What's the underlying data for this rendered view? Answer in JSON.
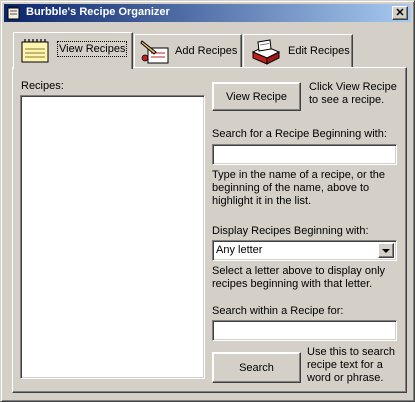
{
  "window": {
    "title": "Burbble's Recipe Organizer",
    "close_glyph": "✕",
    "icon": "recipe-book-icon"
  },
  "tabs": [
    {
      "label": "View Recipes",
      "icon": "notepad-icon",
      "active": true
    },
    {
      "label": "Add Recipes",
      "icon": "pencil-note-icon",
      "active": false
    },
    {
      "label": "Edit Recipes",
      "icon": "recipe-box-icon",
      "active": false
    }
  ],
  "recipes_label": "Recipes:",
  "view": {
    "button_label": "View Recipe",
    "hint": "Click View Recipe to see a recipe."
  },
  "search_beginning": {
    "label": "Search for a Recipe Beginning with:",
    "value": "",
    "hint": "Type in the name of a recipe, or the beginning of the name, above to highlight it in the list."
  },
  "display_beginning": {
    "label": "Display Recipes Beginning with:",
    "selected": "Any letter",
    "hint": "Select a letter above to display only recipes beginning with that letter."
  },
  "search_within": {
    "label": "Search within a Recipe for:",
    "value": "",
    "button_label": "Search",
    "hint": "Use this to search recipe text for a word or phrase."
  }
}
